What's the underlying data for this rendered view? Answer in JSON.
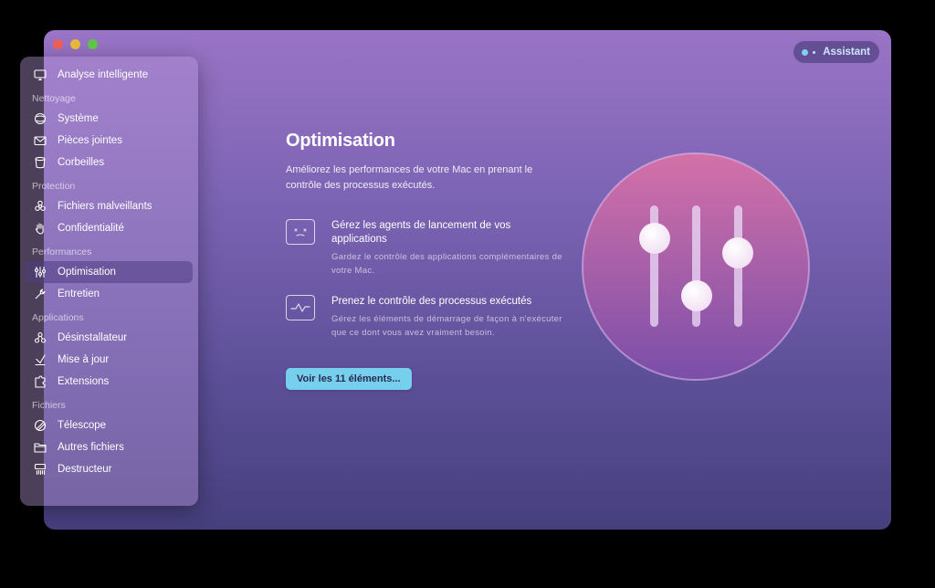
{
  "assistant": {
    "label": "Assistant"
  },
  "sidebar": {
    "sections": [
      {
        "label": "",
        "items": [
          {
            "label": "Analyse intelligente",
            "icon": "monitor-icon"
          }
        ]
      },
      {
        "label": "Nettoyage",
        "items": [
          {
            "label": "Système",
            "icon": "sphere-icon"
          },
          {
            "label": "Pièces jointes",
            "icon": "mail-icon"
          },
          {
            "label": "Corbeilles",
            "icon": "trash-icon"
          }
        ]
      },
      {
        "label": "Protection",
        "items": [
          {
            "label": "Fichiers malveillants",
            "icon": "biohazard-icon"
          },
          {
            "label": "Confidentialité",
            "icon": "hand-icon"
          }
        ]
      },
      {
        "label": "Performances",
        "items": [
          {
            "label": "Optimisation",
            "icon": "sliders-icon",
            "active": true
          },
          {
            "label": "Entretien",
            "icon": "wrench-icon"
          }
        ]
      },
      {
        "label": "Applications",
        "items": [
          {
            "label": "Désinstallateur",
            "icon": "uninstaller-icon"
          },
          {
            "label": "Mise à jour",
            "icon": "update-icon"
          },
          {
            "label": "Extensions",
            "icon": "extensions-icon"
          }
        ]
      },
      {
        "label": "Fichiers",
        "items": [
          {
            "label": "Télescope",
            "icon": "lens-icon"
          },
          {
            "label": "Autres fichiers",
            "icon": "folder-icon"
          },
          {
            "label": "Destructeur",
            "icon": "shredder-icon"
          }
        ]
      }
    ]
  },
  "main": {
    "title": "Optimisation",
    "subtitle": "Améliorez les performances de votre Mac en prenant le contrôle des processus exécutés.",
    "features": [
      {
        "heading": "Gérez les agents de lancement de vos applications",
        "description": "Gardez le contrôle des applications complémentaires de votre Mac.",
        "icon": "launch-agents-icon"
      },
      {
        "heading": "Prenez le contrôle des processus exécutés",
        "description": "Gérez les éléments de démarrage de façon à n'exécuter que ce dont vous avez vraiment besoin.",
        "icon": "processes-icon"
      }
    ],
    "cta_label": "Voir les 11 éléments..."
  },
  "colors": {
    "accent": "#77cfee",
    "window_top": "#9a74c6",
    "window_bottom": "#463f7d",
    "hero_top": "#d471a8",
    "hero_bottom": "#7a4ea9"
  }
}
